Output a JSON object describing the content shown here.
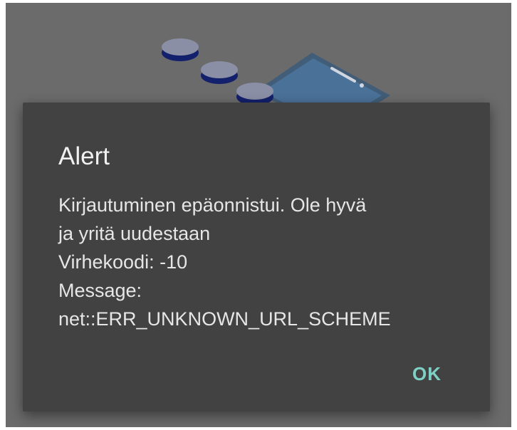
{
  "dialog": {
    "title": "Alert",
    "message_lines": [
      "Kirjautuminen epäonnistui. Ole hyvä",
      "ja yritä uudestaan",
      "Virhekoodi: -10",
      "Message:",
      "net::ERR_UNKNOWN_URL_SCHEME"
    ],
    "ok_label": "OK"
  },
  "colors": {
    "scrim": "#6b6b6b",
    "dialog_bg": "#424242",
    "accent": "#7fd0c4",
    "illustration_primary": "#1f2a8a"
  },
  "icons": {
    "background": "coins-and-phone-illustration-icon"
  }
}
